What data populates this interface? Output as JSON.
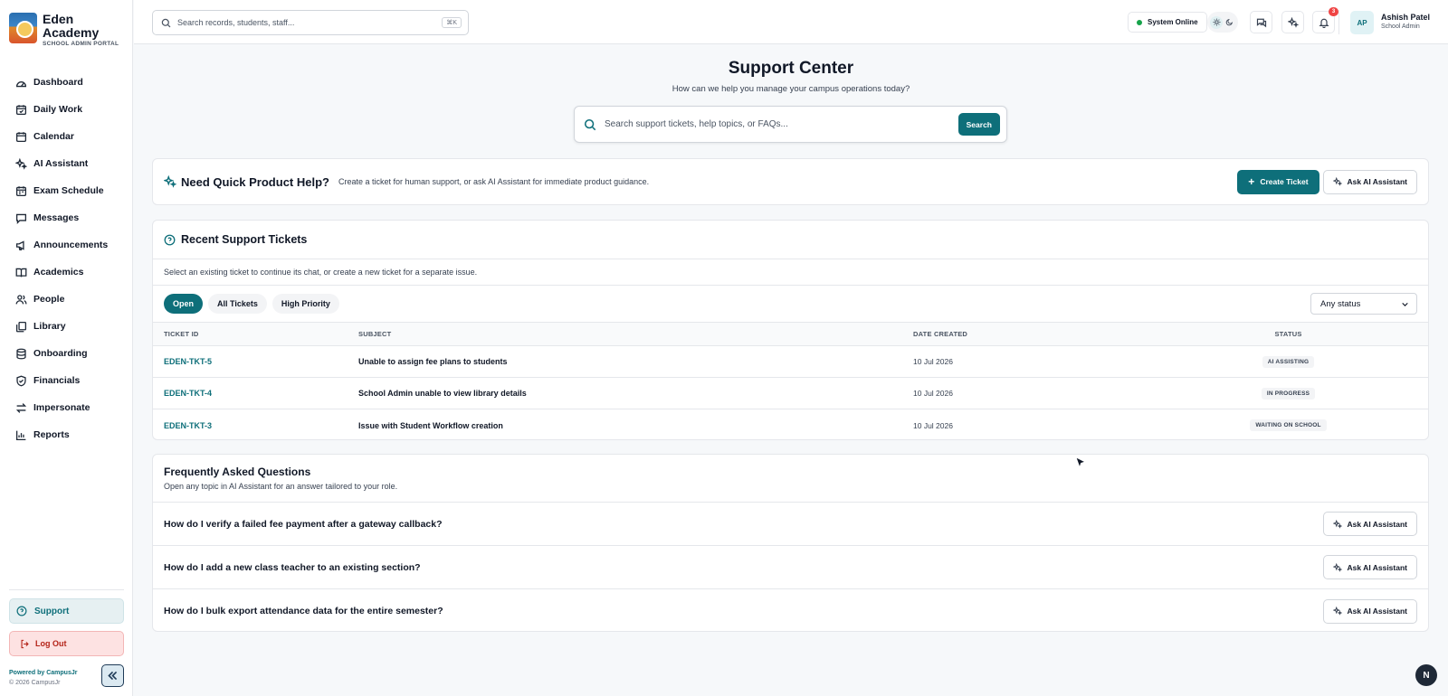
{
  "brand": {
    "name": "Eden Academy",
    "subtitle": "SCHOOL ADMIN PORTAL"
  },
  "sidebar": {
    "items": [
      {
        "label": "Dashboard",
        "icon": "dashboard-icon"
      },
      {
        "label": "Daily Work",
        "icon": "calendar-check-icon"
      },
      {
        "label": "Calendar",
        "icon": "calendar-icon"
      },
      {
        "label": "AI Assistant",
        "icon": "sparkles-icon"
      },
      {
        "label": "Exam Schedule",
        "icon": "calendar-clock-icon"
      },
      {
        "label": "Messages",
        "icon": "message-icon"
      },
      {
        "label": "Announcements",
        "icon": "megaphone-icon"
      },
      {
        "label": "Academics",
        "icon": "book-open-icon"
      },
      {
        "label": "People",
        "icon": "users-icon"
      },
      {
        "label": "Library",
        "icon": "library-icon"
      },
      {
        "label": "Onboarding",
        "icon": "database-icon"
      },
      {
        "label": "Financials",
        "icon": "shield-check-icon"
      },
      {
        "label": "Impersonate",
        "icon": "swap-icon"
      },
      {
        "label": "Reports",
        "icon": "bar-chart-icon"
      }
    ],
    "support_label": "Support",
    "logout_label": "Log Out",
    "powered_by": "Powered by CampusJr",
    "copyright": "© 2026 CampusJr"
  },
  "topbar": {
    "search_placeholder": "Search records, students, staff...",
    "search_shortcut": "⌘K",
    "system_status": "System Online",
    "notification_count": "3",
    "user_initials": "AP",
    "user_name": "Ashish Patel",
    "user_role": "School Admin"
  },
  "hero": {
    "title": "Support Center",
    "subtitle": "How can we help you manage your campus operations today?",
    "search_placeholder": "Search support tickets, help topics, or FAQs...",
    "search_button": "Search"
  },
  "quick_help": {
    "title": "Need Quick Product Help?",
    "description": "Create a ticket for human support, or ask AI Assistant for immediate product guidance.",
    "create_ticket_label": "Create Ticket",
    "ask_ai_label": "Ask AI Assistant"
  },
  "tickets": {
    "title": "Recent Support Tickets",
    "description": "Select an existing ticket to continue its chat, or create a new ticket for a separate issue.",
    "filters": [
      "Open",
      "All Tickets",
      "High Priority"
    ],
    "active_filter": "Open",
    "status_select": "Any status",
    "columns": [
      "TICKET ID",
      "SUBJECT",
      "DATE CREATED",
      "STATUS"
    ],
    "rows": [
      {
        "id": "EDEN-TKT-5",
        "subject": "Unable to assign fee plans to students",
        "date": "10 Jul 2026",
        "status": "AI ASSISTING"
      },
      {
        "id": "EDEN-TKT-4",
        "subject": "School Admin unable to view library details",
        "date": "10 Jul 2026",
        "status": "IN PROGRESS"
      },
      {
        "id": "EDEN-TKT-3",
        "subject": "Issue with Student Workflow creation",
        "date": "10 Jul 2026",
        "status": "WAITING ON SCHOOL"
      }
    ]
  },
  "faq": {
    "title": "Frequently Asked Questions",
    "description": "Open any topic in AI Assistant for an answer tailored to your role.",
    "ask_label": "Ask AI Assistant",
    "questions": [
      "How do I verify a failed fee payment after a gateway callback?",
      "How do I add a new class teacher to an existing section?",
      "How do I bulk export attendance data for the entire semester?"
    ]
  },
  "dev_badge": "N",
  "colors": {
    "accent": "#0e6f7a",
    "danger": "#b42318",
    "online": "#16a34a"
  }
}
